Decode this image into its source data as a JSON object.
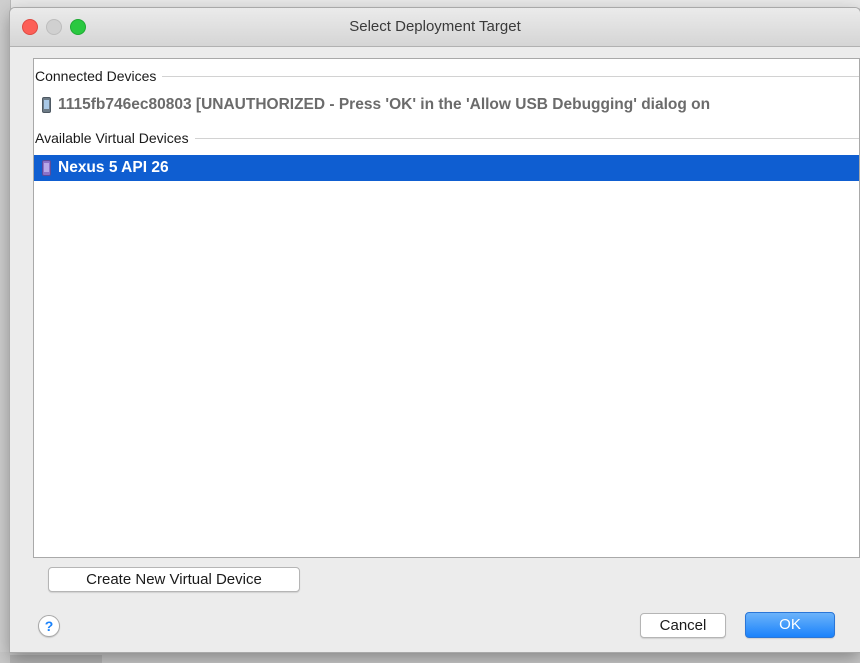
{
  "dialog": {
    "title": "Select Deployment Target"
  },
  "sections": {
    "connected": {
      "label": "Connected Devices",
      "devices": [
        {
          "label": "1115fb746ec80803 [UNAUTHORIZED - Press 'OK' in the 'Allow USB Debugging' dialog on",
          "icon": "phone-icon"
        }
      ]
    },
    "virtual": {
      "label": "Available Virtual Devices",
      "devices": [
        {
          "label": "Nexus 5 API 26",
          "icon": "emulator-phone-icon",
          "selected": true
        }
      ]
    }
  },
  "buttons": {
    "create_label": "Create New Virtual Device",
    "cancel_label": "Cancel",
    "ok_label": "OK",
    "help_label": "?"
  },
  "colors": {
    "selection": "#0f5ed1",
    "ok_button": "#1a82fb",
    "close_traffic": "#fc5f57",
    "zoom_traffic": "#2ac840"
  }
}
